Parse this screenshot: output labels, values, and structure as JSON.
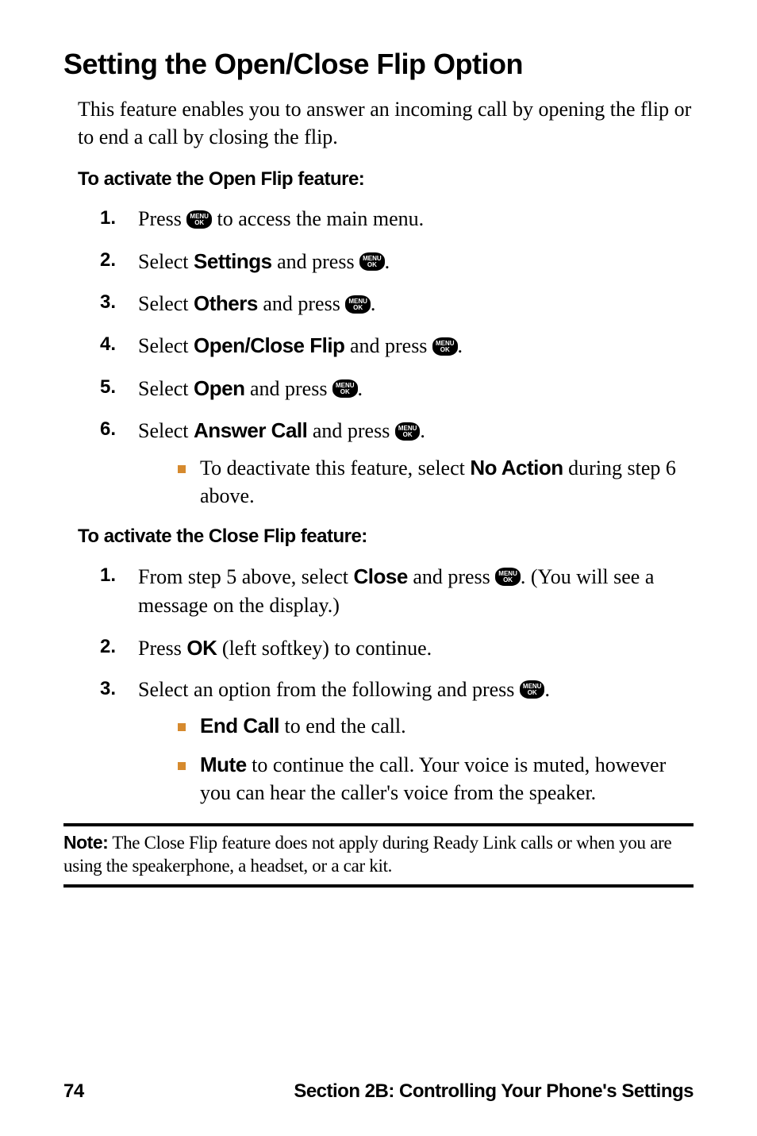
{
  "title": "Setting the Open/Close Flip Option",
  "intro": "This feature enables you to answer an incoming call by opening the flip or to end a call by closing the flip.",
  "icon": {
    "line1": "MENU",
    "line2": "OK"
  },
  "openFlip": {
    "heading": "To activate the Open Flip feature:",
    "steps": [
      {
        "num": "1.",
        "pre": "Press ",
        "post": " to access the main menu.",
        "icon": true
      },
      {
        "num": "2.",
        "pre": "Select ",
        "bold": "Settings",
        "mid": " and press ",
        "icon": true,
        "post": "."
      },
      {
        "num": "3.",
        "pre": "Select ",
        "bold": "Others",
        "mid": " and press ",
        "icon": true,
        "post": "."
      },
      {
        "num": "4.",
        "pre": "Select ",
        "bold": "Open/Close Flip",
        "mid": " and press ",
        "icon": true,
        "post": "."
      },
      {
        "num": "5.",
        "pre": "Select ",
        "bold": "Open",
        "mid": " and press ",
        "icon": true,
        "post": "."
      },
      {
        "num": "6.",
        "pre": "Select ",
        "bold": "Answer Call",
        "mid": " and press ",
        "icon": true,
        "post": "."
      }
    ],
    "sub_bullets": [
      {
        "pre": "To deactivate this feature, select ",
        "bold": "No Action",
        "post": " during step 6 above."
      }
    ]
  },
  "closeFlip": {
    "heading": "To activate the Close Flip feature:",
    "steps": [
      {
        "num": "1.",
        "pre": "From step 5 above, select ",
        "bold": "Close",
        "mid": " and press ",
        "icon": true,
        "post": ". (You will see a message on the display.)"
      },
      {
        "num": "2.",
        "pre": "Press ",
        "bold": "OK",
        "post": " (left softkey) to continue."
      },
      {
        "num": "3.",
        "pre": "Select an option from the following and press ",
        "icon": true,
        "post": "."
      }
    ],
    "sub_bullets": [
      {
        "bold": "End Call",
        "post": " to end the call."
      },
      {
        "bold": "Mute",
        "post": " to continue the call. Your voice is muted, however you can hear the caller's voice from the speaker."
      }
    ]
  },
  "note": {
    "label": "Note:",
    "text": " The Close Flip feature does not apply during Ready Link calls or when you are using the speakerphone, a headset, or a car kit."
  },
  "footer": {
    "page": "74",
    "section": "Section 2B: Controlling Your Phone's Settings"
  }
}
